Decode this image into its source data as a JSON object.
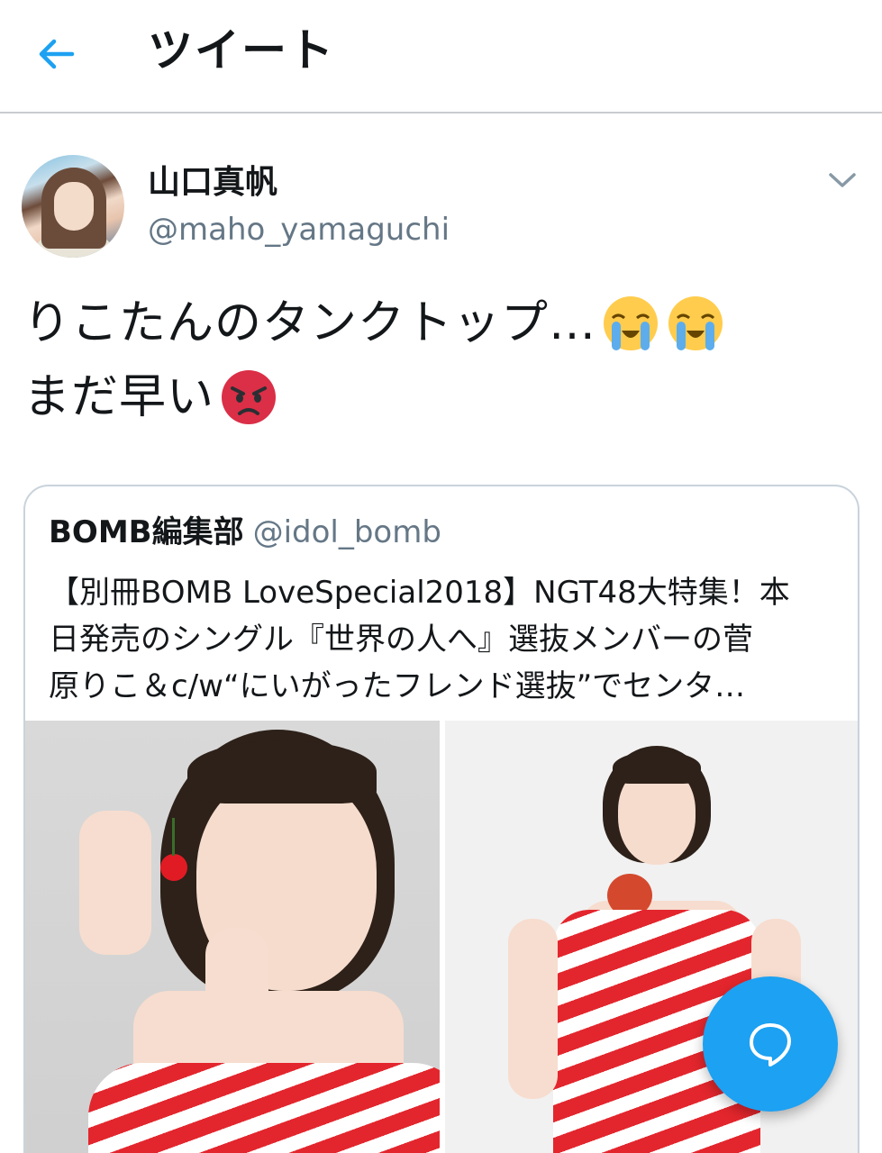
{
  "header": {
    "title": "ツイート",
    "back_icon": "arrow-left-icon",
    "accent": "#1da1f2"
  },
  "tweet": {
    "author": {
      "name": "山口真帆",
      "handle": "@maho_yamaguchi"
    },
    "text_lines": [
      "りこたんのタンクトップ…",
      "まだ早い"
    ],
    "emojis": [
      "loudly-crying-face-icon",
      "loudly-crying-face-icon",
      "pouting-face-icon"
    ],
    "menu_icon": "chevron-down-icon"
  },
  "quote": {
    "name": "BOMB編集部",
    "handle": "@idol_bomb",
    "text_lines": [
      "【別冊BOMB LoveSpecial2018】NGT48大特集！本",
      "日発売のシングル『世界の人へ』選抜メンバーの菅",
      "原りこ＆c/w“にいがったフレンド選抜”でセンタ…"
    ]
  },
  "fab": {
    "icon": "reply-bubble-icon",
    "color": "#1da1f2"
  }
}
